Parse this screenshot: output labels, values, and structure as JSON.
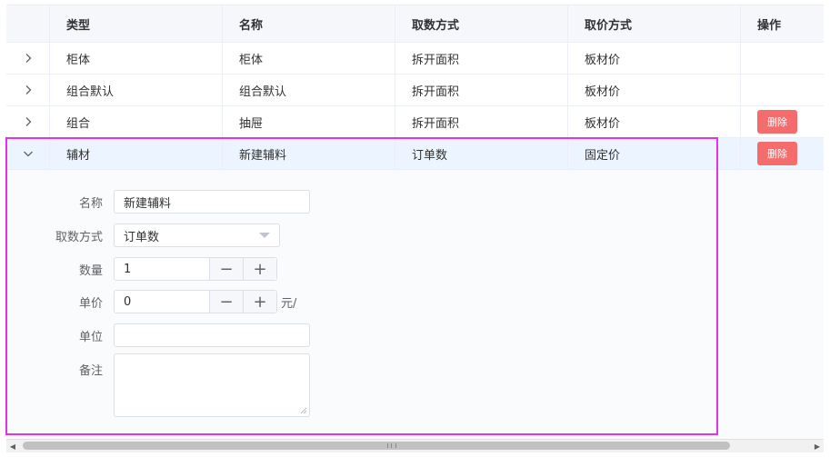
{
  "table": {
    "columns": [
      "类型",
      "名称",
      "取数方式",
      "取价方式",
      "操作"
    ],
    "rows": [
      {
        "type": "柜体",
        "name": "柜体",
        "quantity_method": "拆开面积",
        "price_method": "板材价",
        "action": ""
      },
      {
        "type": "组合默认",
        "name": "组合默认",
        "quantity_method": "拆开面积",
        "price_method": "板材价",
        "action": ""
      },
      {
        "type": "组合",
        "name": "抽屉",
        "quantity_method": "拆开面积",
        "price_method": "板材价",
        "action": "删除"
      },
      {
        "type": "辅材",
        "name": "新建辅料",
        "quantity_method": "订单数",
        "price_method": "固定价",
        "action": "删除"
      }
    ]
  },
  "form": {
    "name_label": "名称",
    "name_value": "新建辅料",
    "method_label": "取数方式",
    "method_value": "订单数",
    "qty_label": "数量",
    "qty_value": "1",
    "price_label": "单价",
    "price_value": "0",
    "price_suffix": "元/",
    "unit_label": "单位",
    "unit_value": "",
    "note_label": "备注",
    "note_value": ""
  },
  "icons": {
    "collapsed": "chevron-right-icon",
    "expanded": "chevron-down-icon",
    "minus": "−",
    "plus": "+"
  },
  "colors": {
    "delete": "#f56c6c",
    "highlight": "#e532e5",
    "active_row": "#ecf5ff"
  }
}
